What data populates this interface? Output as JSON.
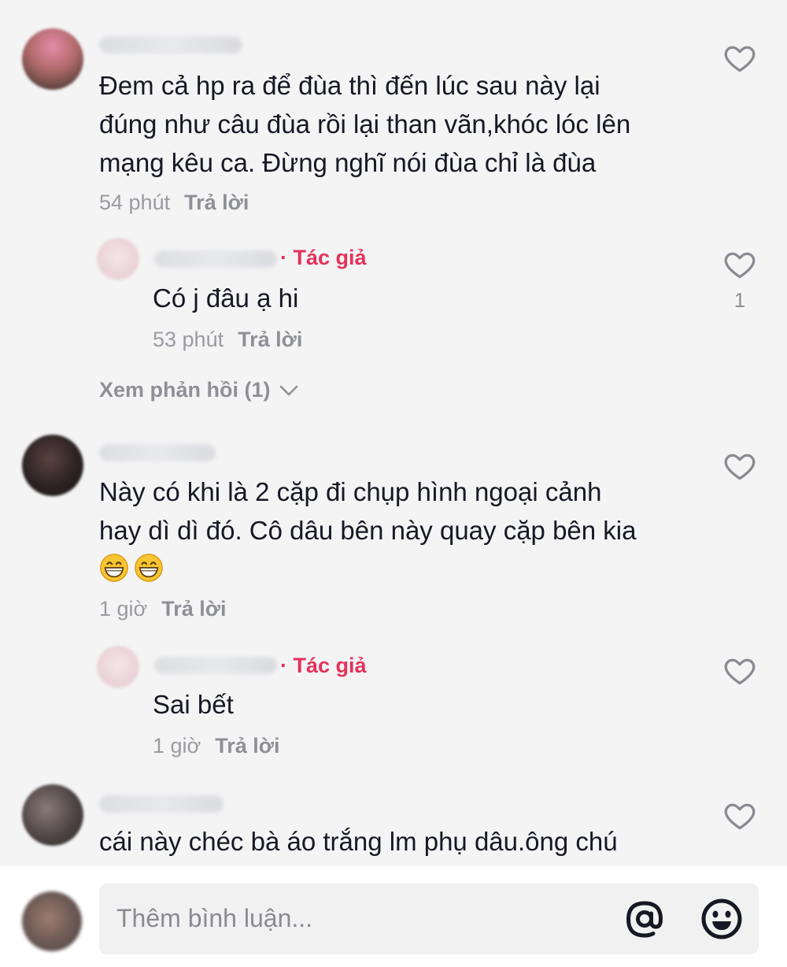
{
  "colors": {
    "background": "#f4f4f5",
    "text": "#161823",
    "muted": "#9a9ba1",
    "author_tag": "#e5325a"
  },
  "comments": [
    {
      "text_lines": [
        "Đem cả hp ra để đùa thì đến lúc sau này lại",
        "đúng như câu đùa rồi lại than vãn,khóc lóc lên",
        "mạng kêu ca. Đừng nghĩ nói đùa chỉ là đùa"
      ],
      "time": "54 phút",
      "reply_label": "Trả lời",
      "icon": "heart-outline-icon",
      "reply": {
        "author_tag": "· Tác giả",
        "text": "Có j đâu ạ hi",
        "time": "53 phút",
        "reply_label": "Trả lời",
        "likes": "1"
      },
      "view_replies": "Xem phản hồi (1)"
    },
    {
      "text_lines": [
        "Này có khi là 2 cặp đi chụp hình ngoại cảnh",
        "hay dì dì đó. Cô dâu bên này quay cặp bên kia"
      ],
      "emoji": [
        "grinning-face-emoji",
        "grinning-face-emoji"
      ],
      "time": "1 giờ",
      "reply_label": "Trả lời",
      "reply": {
        "author_tag": "· Tác giả",
        "text": "Sai bết",
        "time": "1 giờ",
        "reply_label": "Trả lời"
      }
    },
    {
      "text_lines": [
        "cái này chéc bà áo trắng lm phụ dâu.ông chú"
      ]
    }
  ],
  "composer": {
    "placeholder": "Thêm bình luận...",
    "mention_icon": "at-sign-icon",
    "emoji_icon": "emoji-face-icon"
  }
}
